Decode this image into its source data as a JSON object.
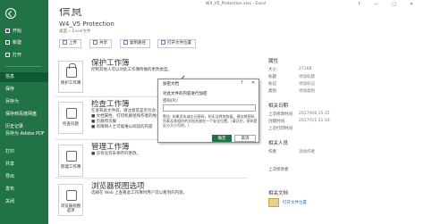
{
  "window": {
    "doc_title": "W4_V5_Protection.xlsx  -  Excel",
    "controls": [
      "?",
      "—",
      "□",
      "✕"
    ]
  },
  "nav": {
    "items": [
      {
        "label": "开始",
        "icon": "home-icon"
      },
      {
        "label": "新建",
        "icon": "new-icon"
      },
      {
        "label": "打开",
        "icon": "open-icon"
      },
      {
        "label": "信息",
        "icon": ""
      },
      {
        "label": "保存",
        "icon": ""
      },
      {
        "label": "另存为",
        "icon": ""
      },
      {
        "label": "保存到百度网盘",
        "icon": ""
      },
      {
        "label": "历史记录",
        "icon": ""
      },
      {
        "label": "打印",
        "icon": ""
      },
      {
        "label": "共享",
        "icon": ""
      },
      {
        "label": "导出",
        "icon": ""
      },
      {
        "label": "另存为 Adobe PDF",
        "icon": ""
      },
      {
        "label": "发布",
        "icon": ""
      },
      {
        "label": "关闭",
        "icon": ""
      }
    ],
    "active_index": 3
  },
  "main": {
    "heading": "信息",
    "doc_name": "W4_V5 Protection",
    "doc_path": "桌面 » Excel文件",
    "toolbar": [
      {
        "label": "上传",
        "icon": "upload-icon"
      },
      {
        "label": "共享",
        "icon": "share-icon"
      },
      {
        "label": "复制路径",
        "icon": "copy-path-icon"
      },
      {
        "label": "打开文件位置",
        "icon": "folder-icon"
      }
    ],
    "sections": [
      {
        "title": "保护工作簿",
        "tile_label": "保护工作簿",
        "desc": [
          "控制其他人可以对此工作簿所做的更改类型。"
        ]
      },
      {
        "title": "检查工作簿",
        "tile_label": "检查问题",
        "desc": [
          "在发布此文件前，请注意其是否包含:",
          "■ 文档属性、打印机路径和作者的姓名",
          "■ 页眉和页脚",
          "■ 有障碍人士可能难以阅读的内容"
        ]
      },
      {
        "title": "管理工作簿",
        "tile_label": "管理工作簿",
        "desc": [
          "■ 没有任何未保存的更改。"
        ]
      },
      {
        "title": "浏览器视图选项",
        "tile_label": "浏览器视图选项",
        "desc": [
          "选择在 Web 上查看此工作簿时用户可以看到的内容。"
        ]
      }
    ]
  },
  "properties": {
    "heading": "属性",
    "rows": [
      {
        "k": "大小",
        "v": "271KB"
      },
      {
        "k": "标题",
        "v": "添加标题"
      },
      {
        "k": "标记",
        "v": "添加标记"
      },
      {
        "k": "类别",
        "v": "添加类别"
      }
    ],
    "dates_heading": "相关日期",
    "dates": [
      {
        "k": "上次修改时间",
        "v": "2017/6/6 15:15"
      },
      {
        "k": "创建时间",
        "v": "2017/5/1 21:19"
      },
      {
        "k": "上次打印时间",
        "v": ""
      }
    ],
    "people_heading": "相关人员",
    "people": [
      {
        "k": "作者",
        "v": "添加作者"
      },
      {
        "k": "上次修改者",
        "v": ""
      }
    ],
    "docs_heading": "相关文档",
    "open_location": "打开文件位置"
  },
  "dialog": {
    "title": "加密文档",
    "help": "?",
    "close": "✕",
    "message": "对此文件的内容进行加密",
    "label": "密码(R):",
    "input_value": "",
    "note": "警告: 如果丢失或忘记密码，则无法将其恢复。建议将密码列表及其相应的文档名放在一个安全位置。(请记住，密码是区分大小写的。)",
    "ok": "确定",
    "cancel": "取消"
  },
  "colors": {
    "nav": "#217346",
    "nav_active": "#0f5a33",
    "arrow": "#d9302b"
  }
}
